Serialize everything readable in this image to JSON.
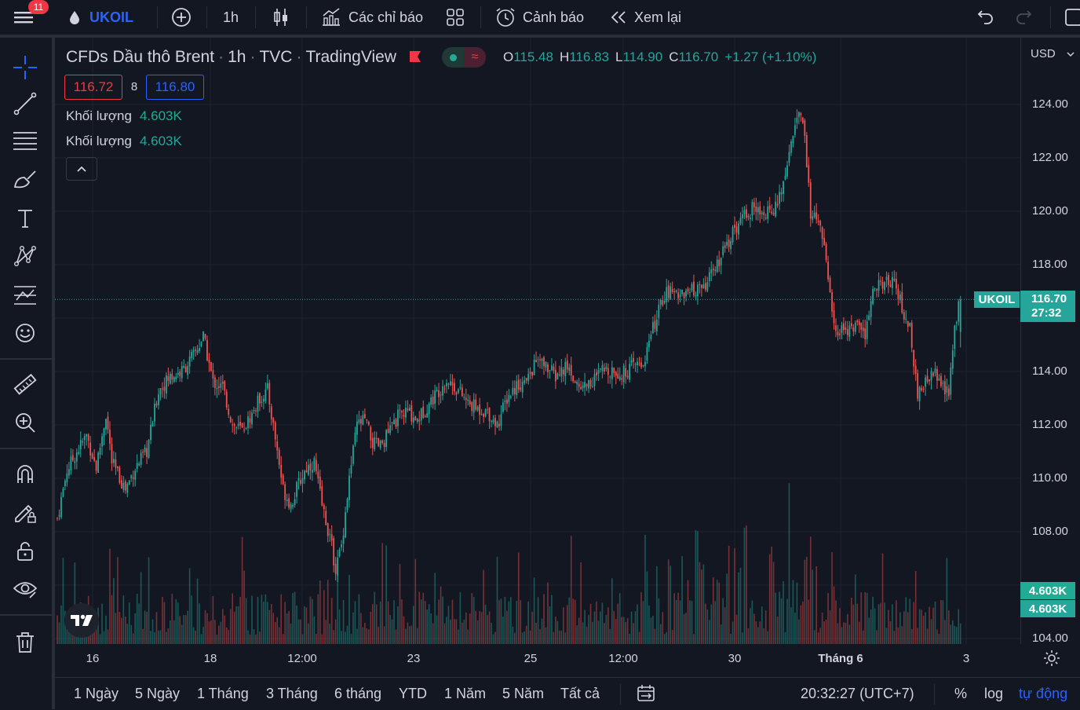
{
  "header": {
    "notification_count": "11",
    "symbol": "UKOIL",
    "interval": "1h",
    "indicators_label": "Các chỉ báo",
    "alert_label": "Cảnh báo",
    "replay_label": "Xem lại"
  },
  "legend": {
    "title": "CFDs Dầu thô Brent",
    "interval": "1h",
    "exchange": "TVC",
    "source": "TradingView",
    "o_label": "O",
    "o_value": "115.48",
    "h_label": "H",
    "h_value": "116.83",
    "l_label": "L",
    "l_value": "114.90",
    "c_label": "C",
    "c_value": "116.70",
    "change": "+1.27 (+1.10%)",
    "bid": "116.72",
    "spread": "8",
    "ask": "116.80",
    "volume_rows": [
      {
        "label": "Khối lượng",
        "value": "4.603K",
        "color": "#22ab94"
      },
      {
        "label": "Khối lượng",
        "value": "4.603K",
        "color": "#26a69a"
      }
    ]
  },
  "price_scale": {
    "currency": "USD",
    "ticks": [
      "124.00",
      "122.00",
      "120.00",
      "118.00",
      "114.00",
      "112.00",
      "110.00",
      "108.00",
      "104.00"
    ],
    "last_symbol": "UKOIL",
    "last_price": "116.70",
    "countdown": "27:32",
    "volume_labels": [
      "4.603K",
      "4.603K"
    ]
  },
  "time_scale": {
    "ticks": [
      "16",
      "18",
      "12:00",
      "23",
      "25",
      "12:00",
      "30",
      "Tháng 6",
      "3"
    ]
  },
  "bottom": {
    "ranges": [
      "1 Ngày",
      "5 Ngày",
      "1 Tháng",
      "3 Tháng",
      "6 tháng",
      "YTD",
      "1 Năm",
      "5 Năm",
      "Tất cả"
    ],
    "clock": "20:32:27 (UTC+7)",
    "percent": "%",
    "log": "log",
    "auto": "tự động"
  },
  "colors": {
    "background": "#131722",
    "up": "#26a69a",
    "down": "#ef5350",
    "accent": "#2962ff",
    "grid": "#1f2330"
  },
  "chart_data": {
    "type": "candlestick",
    "symbol": "UKOIL",
    "interval": "1h",
    "x_ticks": [
      "16",
      "18",
      "12:00",
      "23",
      "25",
      "12:00",
      "30",
      "Tháng 6",
      "3"
    ],
    "y_ticks": [
      124,
      122,
      120,
      118,
      114,
      112,
      110,
      108,
      104
    ],
    "ylim": [
      104,
      126
    ],
    "last_price": 116.7,
    "close_path": [
      [
        0,
        108.5
      ],
      [
        5,
        110.3
      ],
      [
        10,
        111.0
      ],
      [
        15,
        111.6
      ],
      [
        20,
        110.4
      ],
      [
        25,
        112.4
      ],
      [
        28,
        110.6
      ],
      [
        35,
        109.6
      ],
      [
        40,
        110.4
      ],
      [
        46,
        111.0
      ],
      [
        52,
        113.3
      ],
      [
        58,
        113.8
      ],
      [
        64,
        114.0
      ],
      [
        70,
        114.6
      ],
      [
        75,
        115.3
      ],
      [
        80,
        113.6
      ],
      [
        85,
        113.4
      ],
      [
        90,
        112.0
      ],
      [
        95,
        111.8
      ],
      [
        100,
        112.4
      ],
      [
        104,
        113.0
      ],
      [
        108,
        113.3
      ],
      [
        112,
        111.5
      ],
      [
        116,
        109.6
      ],
      [
        120,
        109.0
      ],
      [
        124,
        109.8
      ],
      [
        128,
        110.4
      ],
      [
        132,
        110.6
      ],
      [
        136,
        109.0
      ],
      [
        140,
        107.8
      ],
      [
        143,
        106.6
      ],
      [
        146,
        107.5
      ],
      [
        150,
        110.0
      ],
      [
        154,
        112.0
      ],
      [
        158,
        112.2
      ],
      [
        162,
        111.3
      ],
      [
        166,
        111.2
      ],
      [
        170,
        111.7
      ],
      [
        175,
        112.3
      ],
      [
        180,
        112.5
      ],
      [
        185,
        112.2
      ],
      [
        190,
        112.7
      ],
      [
        196,
        113.3
      ],
      [
        200,
        113.7
      ],
      [
        206,
        113.3
      ],
      [
        211,
        112.8
      ],
      [
        216,
        112.6
      ],
      [
        221,
        112.5
      ],
      [
        226,
        112.0
      ],
      [
        231,
        113.0
      ],
      [
        236,
        113.5
      ],
      [
        241,
        113.6
      ],
      [
        246,
        114.4
      ],
      [
        251,
        114.2
      ],
      [
        256,
        113.8
      ],
      [
        262,
        114.2
      ],
      [
        268,
        113.4
      ],
      [
        274,
        113.6
      ],
      [
        280,
        114.0
      ],
      [
        285,
        114.1
      ],
      [
        290,
        113.9
      ],
      [
        296,
        114.2
      ],
      [
        301,
        114.3
      ],
      [
        306,
        115.6
      ],
      [
        312,
        116.9
      ],
      [
        318,
        117.0
      ],
      [
        323,
        116.9
      ],
      [
        328,
        117.1
      ],
      [
        333,
        117.3
      ],
      [
        338,
        117.8
      ],
      [
        343,
        118.6
      ],
      [
        348,
        119.3
      ],
      [
        353,
        119.8
      ],
      [
        357,
        120.1
      ],
      [
        362,
        119.8
      ],
      [
        366,
        120.0
      ],
      [
        370,
        120.2
      ],
      [
        374,
        121.6
      ],
      [
        378,
        123.0
      ],
      [
        381,
        123.6
      ],
      [
        383,
        123.5
      ],
      [
        387,
        120.0
      ],
      [
        390,
        119.6
      ],
      [
        393,
        119.2
      ],
      [
        396,
        117.5
      ],
      [
        400,
        115.5
      ],
      [
        405,
        115.6
      ],
      [
        410,
        115.7
      ],
      [
        415,
        115.3
      ],
      [
        420,
        117.3
      ],
      [
        425,
        117.2
      ],
      [
        430,
        117.6
      ],
      [
        435,
        116.0
      ],
      [
        438,
        115.7
      ],
      [
        442,
        113.0
      ],
      [
        446,
        113.6
      ],
      [
        450,
        114.1
      ],
      [
        454,
        113.5
      ],
      [
        458,
        113.1
      ],
      [
        461,
        115.5
      ],
      [
        463,
        116.7
      ]
    ],
    "volume_last": "4.603K"
  }
}
